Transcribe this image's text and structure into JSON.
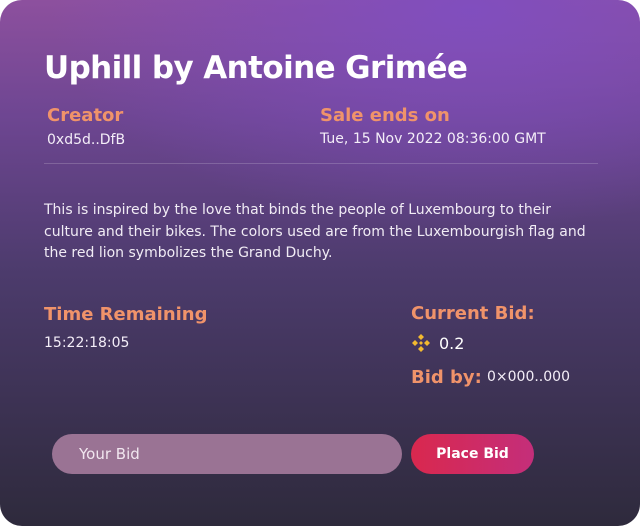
{
  "title": "Uphill by Antoine Grimée",
  "creator": {
    "label": "Creator",
    "value": "0xd5d..DfB"
  },
  "sale": {
    "label": "Sale ends on",
    "value": "Tue, 15 Nov 2022 08:36:00 GMT"
  },
  "description": "This is inspired by the love that binds the people of Luxembourg to their culture and their bikes. The colors used are from the Luxembourgish flag and the red lion symbolizes the Grand Duchy.",
  "time_remaining": {
    "label": "Time Remaining",
    "value": "15:22:18:05"
  },
  "current_bid": {
    "label": "Current Bid:",
    "amount": "0.2",
    "currency_icon": "bnb-icon",
    "bid_by_label": "Bid by:",
    "bid_by_value": "0×000..000"
  },
  "bid_form": {
    "placeholder": "Your Bid",
    "button_label": "Place Bid"
  },
  "colors": {
    "accent_label": "#f0936a",
    "button_start": "#d9284e",
    "button_end": "#c42e7a",
    "input_bg": "#9a7394",
    "bnb_gold": "#f3ba2f"
  }
}
